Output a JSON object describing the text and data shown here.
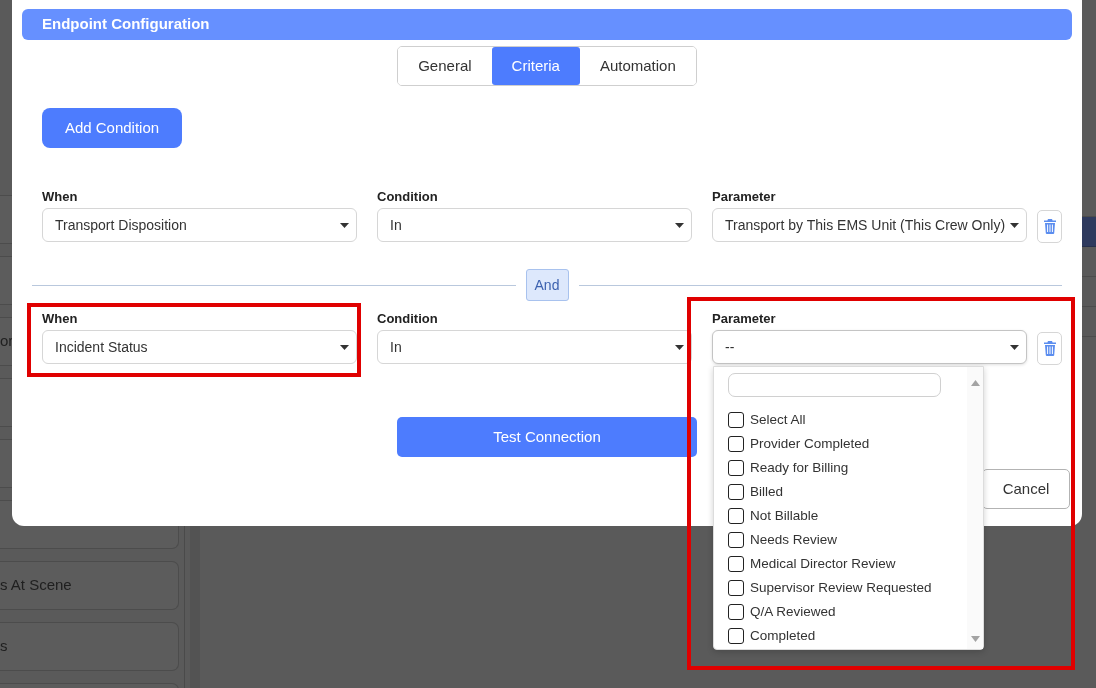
{
  "background": {
    "sidebar_cards": [
      {
        "kind": "blank"
      },
      {
        "kind": "blank"
      },
      {
        "kind": "text",
        "label": "or"
      },
      {
        "kind": "blank"
      },
      {
        "kind": "blank"
      },
      {
        "kind": "blank"
      },
      {
        "kind": "text",
        "label": "s At Scene"
      },
      {
        "kind": "text",
        "label": "s"
      },
      {
        "kind": "blank"
      }
    ],
    "list_rows": [
      {
        "selected": false
      },
      {
        "selected": true
      },
      {
        "selected": false
      },
      {
        "selected": false
      },
      {
        "selected": false
      }
    ]
  },
  "modal": {
    "title": "Endpoint Configuration",
    "tabs": [
      {
        "label": "General",
        "selected": false
      },
      {
        "label": "Criteria",
        "selected": true
      },
      {
        "label": "Automation",
        "selected": false
      }
    ],
    "add_button": "Add Condition",
    "conditions": [
      {
        "when": {
          "label": "When",
          "value": "Transport Disposition",
          "highlighted": false
        },
        "condition": {
          "label": "Condition",
          "value": "In",
          "highlighted": false
        },
        "parameter": {
          "label": "Parameter",
          "value": "Transport by This EMS Unit (This Crew Only)",
          "highlighted": false,
          "expanded": false
        }
      },
      {
        "when": {
          "label": "When",
          "value": "Incident Status",
          "highlighted": true
        },
        "condition": {
          "label": "Condition",
          "value": "In",
          "highlighted": false
        },
        "parameter": {
          "label": "Parameter",
          "value": "--",
          "highlighted": true,
          "expanded": true,
          "options": [
            {
              "label": "Select All",
              "checked": false
            },
            {
              "label": "Provider Completed",
              "checked": false
            },
            {
              "label": "Ready for Billing",
              "checked": false
            },
            {
              "label": "Billed",
              "checked": false
            },
            {
              "label": "Not Billable",
              "checked": false
            },
            {
              "label": "Needs Review",
              "checked": false
            },
            {
              "label": "Medical Director Review",
              "checked": false
            },
            {
              "label": "Supervisor Review Requested",
              "checked": false
            },
            {
              "label": "Q/A Reviewed",
              "checked": false
            },
            {
              "label": "Completed",
              "checked": false
            }
          ]
        }
      }
    ],
    "joiner": "And",
    "test_button": "Test Connection",
    "cancel_button": "Cancel"
  }
}
